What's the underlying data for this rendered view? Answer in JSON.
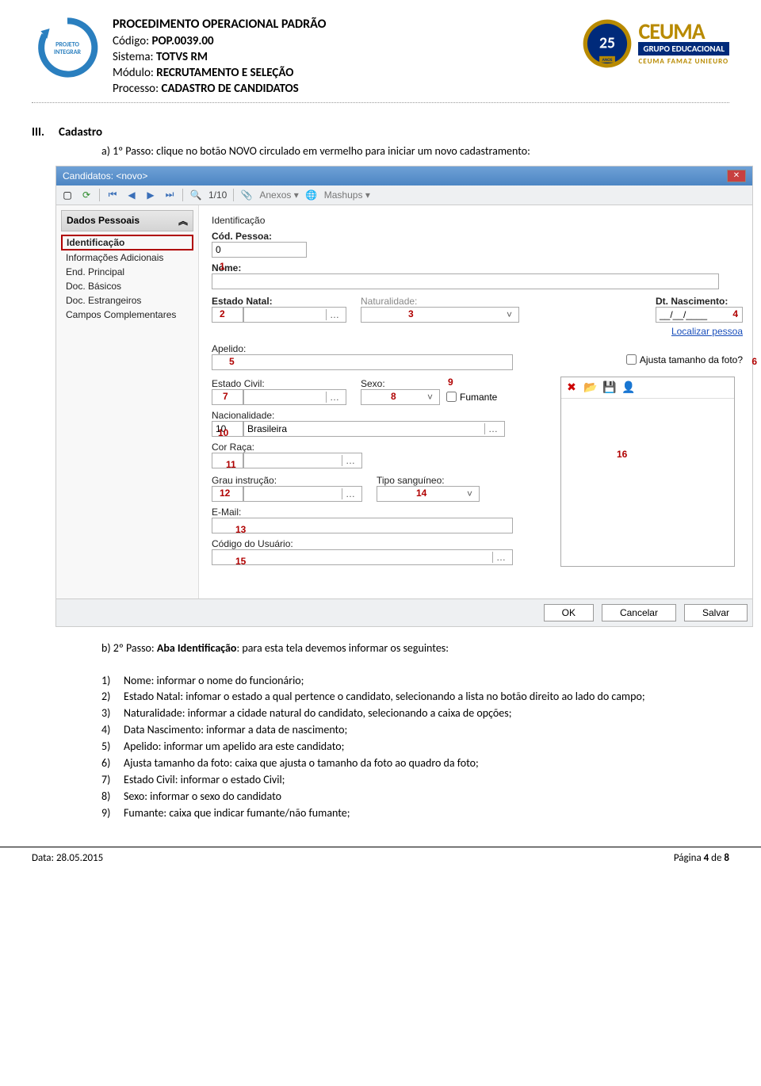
{
  "header": {
    "title": "PROCEDIMENTO OPERACIONAL PADRÃO",
    "codigoLabel": "Código:",
    "codigo": "POP.0039.00",
    "sistemaLabel": "Sistema:",
    "sistema": "TOTVS RM",
    "moduloLabel": "Módulo:",
    "modulo": "RECRUTAMENTO E SELEÇÃO",
    "processoLabel": "Processo:",
    "processo": "CADASTRO DE CANDIDATOS",
    "logoIntegrar": "PROJETO INTEGRAR",
    "ceumaName": "CEUMA",
    "ceumaSub": "GRUPO EDUCACIONAL",
    "ceumaLine": "CEUMA FAMAZ UNIEURO",
    "anos": "25",
    "anosLabel": "ANOS"
  },
  "section": {
    "roman": "III.",
    "title": "Cadastro",
    "a_label": "a)",
    "a_text": "1º Passo: clique no botão NOVO circulado em vermelho para iniciar um novo cadastramento:",
    "b_label": "b)",
    "b_prefix": "2º Passo: ",
    "b_bold": "Aba Identificação",
    "b_suffix": ": para esta tela devemos informar os seguintes:"
  },
  "win": {
    "title": "Candidatos: <novo>",
    "close": "✕",
    "pager": "1/10",
    "anexos": "Anexos",
    "mashups": "Mashups",
    "sideHeader": "Dados Pessoais",
    "chevron": "︽",
    "sideItems": [
      "Identificação",
      "Informações Adicionais",
      "End. Principal",
      "Doc. Básicos",
      "Doc. Estrangeiros",
      "Campos Complementares"
    ],
    "labels": {
      "identificacao": "Identificação",
      "codPessoa": "Cód. Pessoa:",
      "codPessoaVal": "0",
      "nome": "Nome:",
      "estadoNatal": "Estado Natal:",
      "naturalidade": "Naturalidade:",
      "dtNasc": "Dt. Nascimento:",
      "dtNascMask": "__/__/____",
      "localizar": "Localizar pessoa",
      "apelido": "Apelido:",
      "ajustaFoto": "Ajusta tamanho da foto?",
      "estadoCivil": "Estado Civil:",
      "sexo": "Sexo:",
      "fumante": "Fumante",
      "nacionalidade": "Nacionalidade:",
      "nacCod": "10",
      "nacVal": "Brasileira",
      "corRaca": "Cor Raça:",
      "grau": "Grau instrução:",
      "tipoSang": "Tipo sanguíneo:",
      "email": "E-Mail:",
      "codUsuario": "Código do Usuário:"
    },
    "annots": {
      "n1": "1",
      "n2": "2",
      "n3": "3",
      "n4": "4",
      "n5": "5",
      "n6": "6",
      "n7": "7",
      "n8": "8",
      "n9": "9",
      "n10": "10",
      "n11": "11",
      "n12": "12",
      "n13": "13",
      "n14": "14",
      "n15": "15",
      "n16": "16"
    },
    "icons": {
      "new": "▢",
      "refresh": "⟳",
      "first": "⏮",
      "prev": "◀",
      "next": "▶",
      "last": "⏭",
      "find": "🔍",
      "attach": "📎",
      "globe": "🌐",
      "dropdown": "▾",
      "photoDel": "✖",
      "photoOpen": "📂",
      "photoSave": "💾",
      "photoUser": "👤"
    },
    "buttons": {
      "ok": "OK",
      "cancel": "Cancelar",
      "save": "Salvar"
    }
  },
  "list": {
    "items": [
      {
        "n": "1)",
        "t": "Nome: informar o nome do funcionário;"
      },
      {
        "n": "2)",
        "t": "Estado Natal: infomar o estado a qual pertence o candidato, selecionando a lista no botão direito ao lado do campo;"
      },
      {
        "n": "3)",
        "t": "Naturalidade: informar a cidade natural do candidato, selecionando a caixa de opções;"
      },
      {
        "n": "4)",
        "t": "Data Nascimento: informar a data de nascimento;"
      },
      {
        "n": "5)",
        "t": "Apelido: informar um apelido ara este candidato;"
      },
      {
        "n": "6)",
        "t": "Ajusta tamanho da foto:  caixa que ajusta o tamanho da foto ao quadro da foto;"
      },
      {
        "n": "7)",
        "t": "Estado Civil: informar o estado Civil;"
      },
      {
        "n": "8)",
        "t": "Sexo: informar o sexo do candidato"
      },
      {
        "n": "9)",
        "t": "Fumante: caixa que indicar fumante/não fumante;"
      }
    ]
  },
  "footer": {
    "dateLabel": "Data: ",
    "date": "28.05.2015",
    "pagePrefix": "Página ",
    "pageNum": "4",
    "pageMid": " de ",
    "pageTotal": "8"
  }
}
